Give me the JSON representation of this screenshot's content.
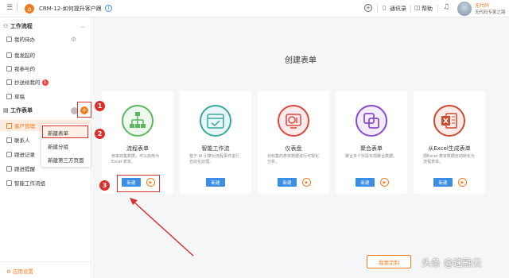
{
  "topbar": {
    "app_title": "CRM-12-如何提升客户跟",
    "info_icon": "info-icon",
    "contacts_label": "通讯录",
    "help_label": "帮助",
    "user_name": "无代码",
    "user_sub": "无代码专家之路"
  },
  "sidebar": {
    "workflow_header": "工作流程",
    "workflow_items": [
      {
        "label": "我的待办"
      },
      {
        "label": "我发起的"
      },
      {
        "label": "我参与的"
      },
      {
        "label": "抄送给我的",
        "badge": "1"
      },
      {
        "label": "草稿"
      }
    ],
    "forms_header": "工作表单",
    "form_items": [
      {
        "label": "客户管理"
      },
      {
        "label": "联系人"
      },
      {
        "label": "跟进记录"
      },
      {
        "label": "跟进提醒"
      },
      {
        "label": "智能工作流组"
      }
    ],
    "settings_label": "应用设置"
  },
  "dropdown": {
    "items": [
      {
        "label": "新建表单"
      },
      {
        "label": "新建分组"
      },
      {
        "label": "新建第三方页面"
      }
    ]
  },
  "steps": [
    "1",
    "2",
    "3"
  ],
  "main": {
    "title": "创建表单",
    "cards": [
      {
        "title": "流程表单",
        "desc": "用来收集数据，可以启用为Excel 表单。",
        "new_label": "新建",
        "icon_color": "#5cb85c"
      },
      {
        "title": "智能工作流",
        "desc": "基于 AI 引擎对流程事件进行自动化处理。",
        "new_label": "新建",
        "icon_color": "#3aa8a0"
      },
      {
        "title": "仪表盘",
        "desc": "对收集的表单数据进行可视化分析。",
        "new_label": "新建",
        "icon_color": "#e0473f"
      },
      {
        "title": "聚合表单",
        "desc": "聚合多个字段实现聚合数据。",
        "new_label": "新建",
        "icon_color": "#8a4cc9"
      },
      {
        "title": "从Excel生成表单",
        "desc": "把Excel 表单数据自动转化为流程表单。",
        "new_label": "新建",
        "icon_color": "#d04a2f"
      }
    ],
    "custom_button": "我要定制"
  },
  "watermark": "头条 @速融云",
  "colors": {
    "accent": "#f47c20",
    "primary_button": "#3a8ee6",
    "annotation_red": "#d9302c"
  }
}
